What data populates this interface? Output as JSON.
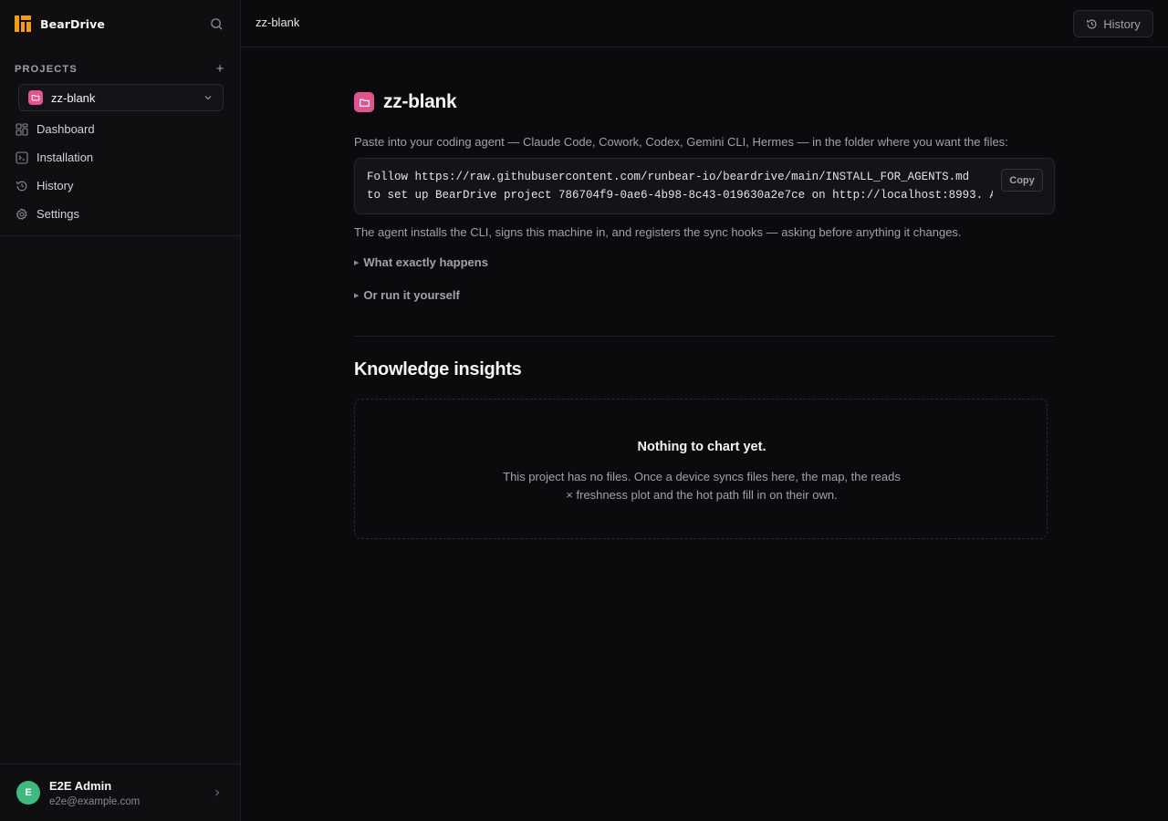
{
  "sidebar": {
    "brand": "BearDrive",
    "projects_label": "PROJECTS",
    "add_symbol": "+",
    "selected_project": "zz-blank",
    "nav": [
      {
        "label": "Dashboard",
        "icon": "dashboard-icon"
      },
      {
        "label": "Installation",
        "icon": "installation-icon"
      },
      {
        "label": "History",
        "icon": "history-icon"
      },
      {
        "label": "Settings",
        "icon": "gear-icon"
      }
    ],
    "user": {
      "initial": "E",
      "name": "E2E Admin",
      "email": "e2e@example.com"
    }
  },
  "topbar": {
    "title": "zz-blank",
    "history_label": "History"
  },
  "main": {
    "title": "zz-blank",
    "instructions": "Paste into your coding agent — Claude Code, Cowork, Codex, Gemini CLI, Hermes — in the folder where you want the files:",
    "code_line1": "Follow https://raw.githubusercontent.com/runbear-io/beardrive/main/INSTALL_FOR_AGENTS.md",
    "code_line2": "to set up BearDrive project 786704f9-0ae6-4b98-8c43-019630a2e7ce on http://localhost:8993. A",
    "copy_label": "Copy",
    "agent_note": "The agent installs the CLI, signs this machine in, and registers the sync hooks — asking before anything it changes.",
    "disclosure1": "What exactly happens",
    "disclosure2": "Or run it yourself",
    "insights_title": "Knowledge insights",
    "empty_title": "Nothing to chart yet.",
    "empty_desc": "This project has no files. Once a device syncs files here, the map, the reads × freshness plot and the hot path fill in on their own."
  },
  "colors": {
    "background": "#0b0b0d",
    "sidebar": "#0f0f12",
    "accent_brand": "#f59e0b",
    "project_pink": "#e0558f",
    "avatar_green": "#3fb97f"
  }
}
